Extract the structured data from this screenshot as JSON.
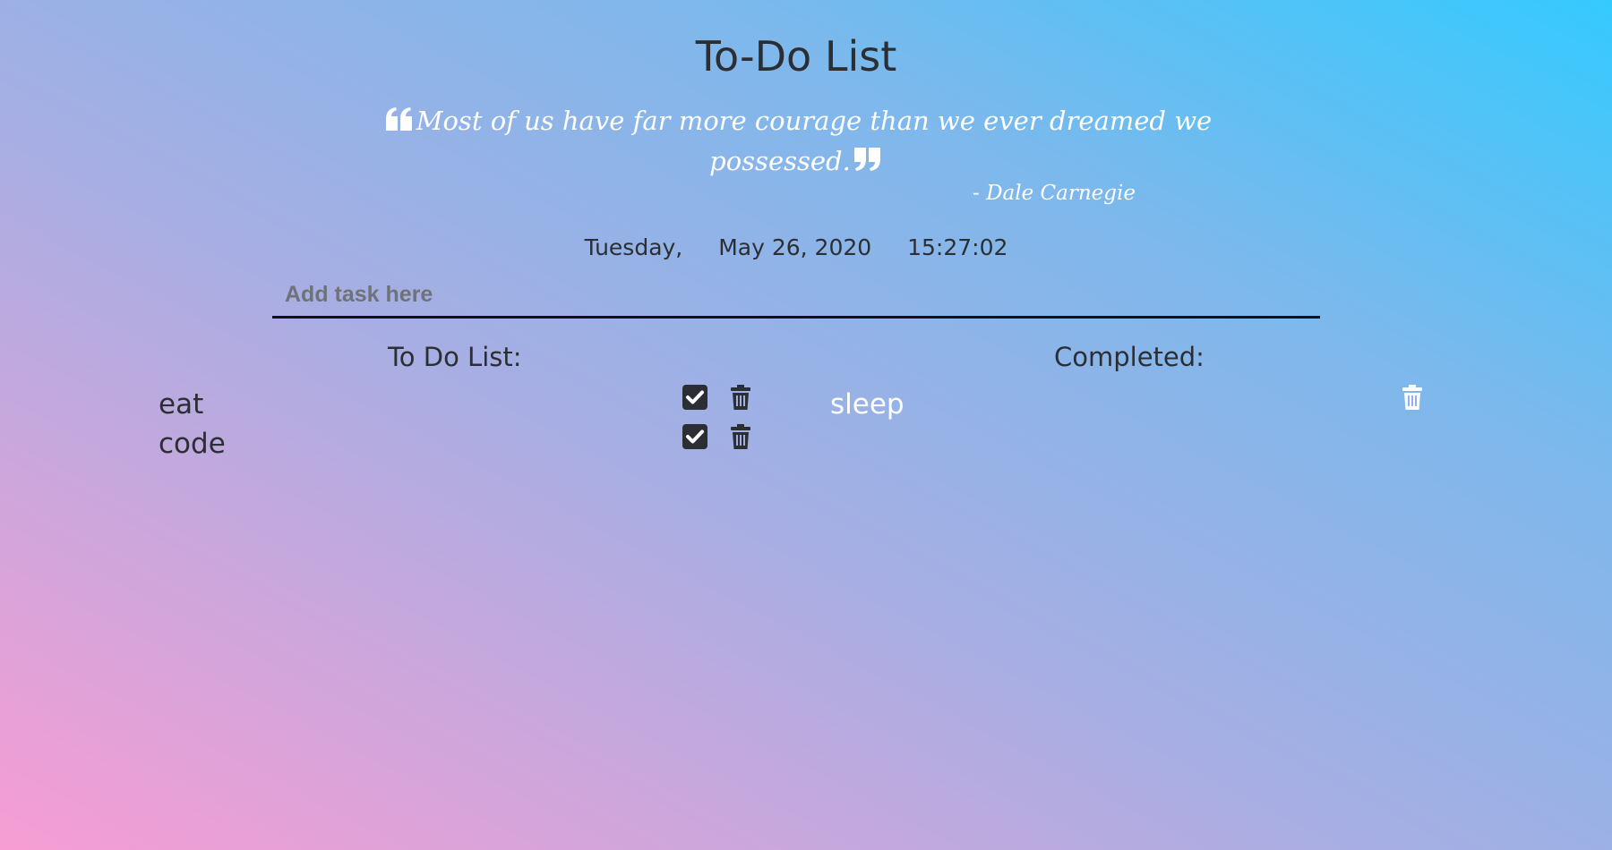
{
  "header": {
    "title": "To-Do List"
  },
  "quote": {
    "text": "Most of us have far more courage than we ever dreamed we possessed.",
    "author": "- Dale Carnegie"
  },
  "clock": {
    "weekday": "Tuesday,",
    "date": "May 26, 2020",
    "time": "15:27:02"
  },
  "input": {
    "placeholder": "Add task here",
    "value": ""
  },
  "todo": {
    "heading": "To Do List:",
    "items": [
      {
        "label": "eat"
      },
      {
        "label": "code"
      }
    ]
  },
  "completed": {
    "heading": "Completed:",
    "items": [
      {
        "label": "sleep"
      }
    ]
  },
  "icons": {
    "quote_open": "quote-left-icon",
    "quote_close": "quote-right-icon",
    "check": "check-square-icon",
    "delete": "trash-icon"
  },
  "colors": {
    "text_dark": "#2b2f33",
    "text_light": "#ffffff",
    "gradient_start": "#f79dd3",
    "gradient_end": "#34cafe",
    "input_underline": "#111111"
  }
}
